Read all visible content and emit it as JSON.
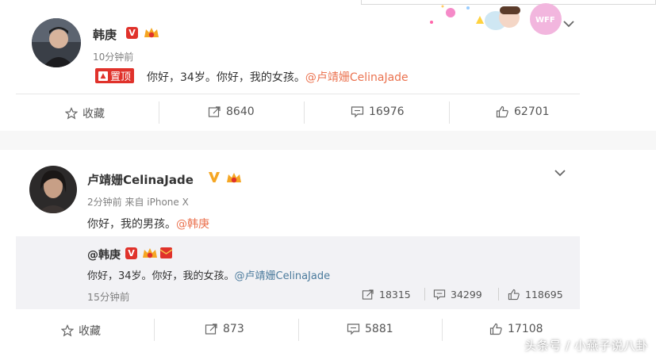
{
  "post1": {
    "username": "韩庚",
    "time": "10分钟前",
    "pin_label": "置顶",
    "text": "你好，34岁。你好，我的女孩。",
    "mention": "@卢靖姗CelinaJade",
    "actions": {
      "favorite": "收藏",
      "repost": "8640",
      "comment": "16976",
      "like": "62701"
    }
  },
  "post2": {
    "username": "卢靖姗CelinaJade",
    "meta": "2分钟前 来自 iPhone X",
    "text": "你好，我的男孩。",
    "mention": "@韩庚",
    "quote": {
      "username": "@韩庚",
      "text": "你好，34岁。你好，我的女孩。",
      "mention": "@卢靖姗CelinaJade",
      "time": "15分钟前",
      "repost": "18315",
      "comment": "34299",
      "like": "118695"
    },
    "actions": {
      "favorite": "收藏",
      "repost": "873",
      "comment": "5881",
      "like": "17108"
    }
  },
  "banner": {
    "badge_text": "WFF"
  },
  "watermark": "头条号 / 小燕子说八卦",
  "colors": {
    "orange_link": "#eb7350",
    "verified_red": "#e0322b",
    "verified_gold": "#f5a623"
  }
}
